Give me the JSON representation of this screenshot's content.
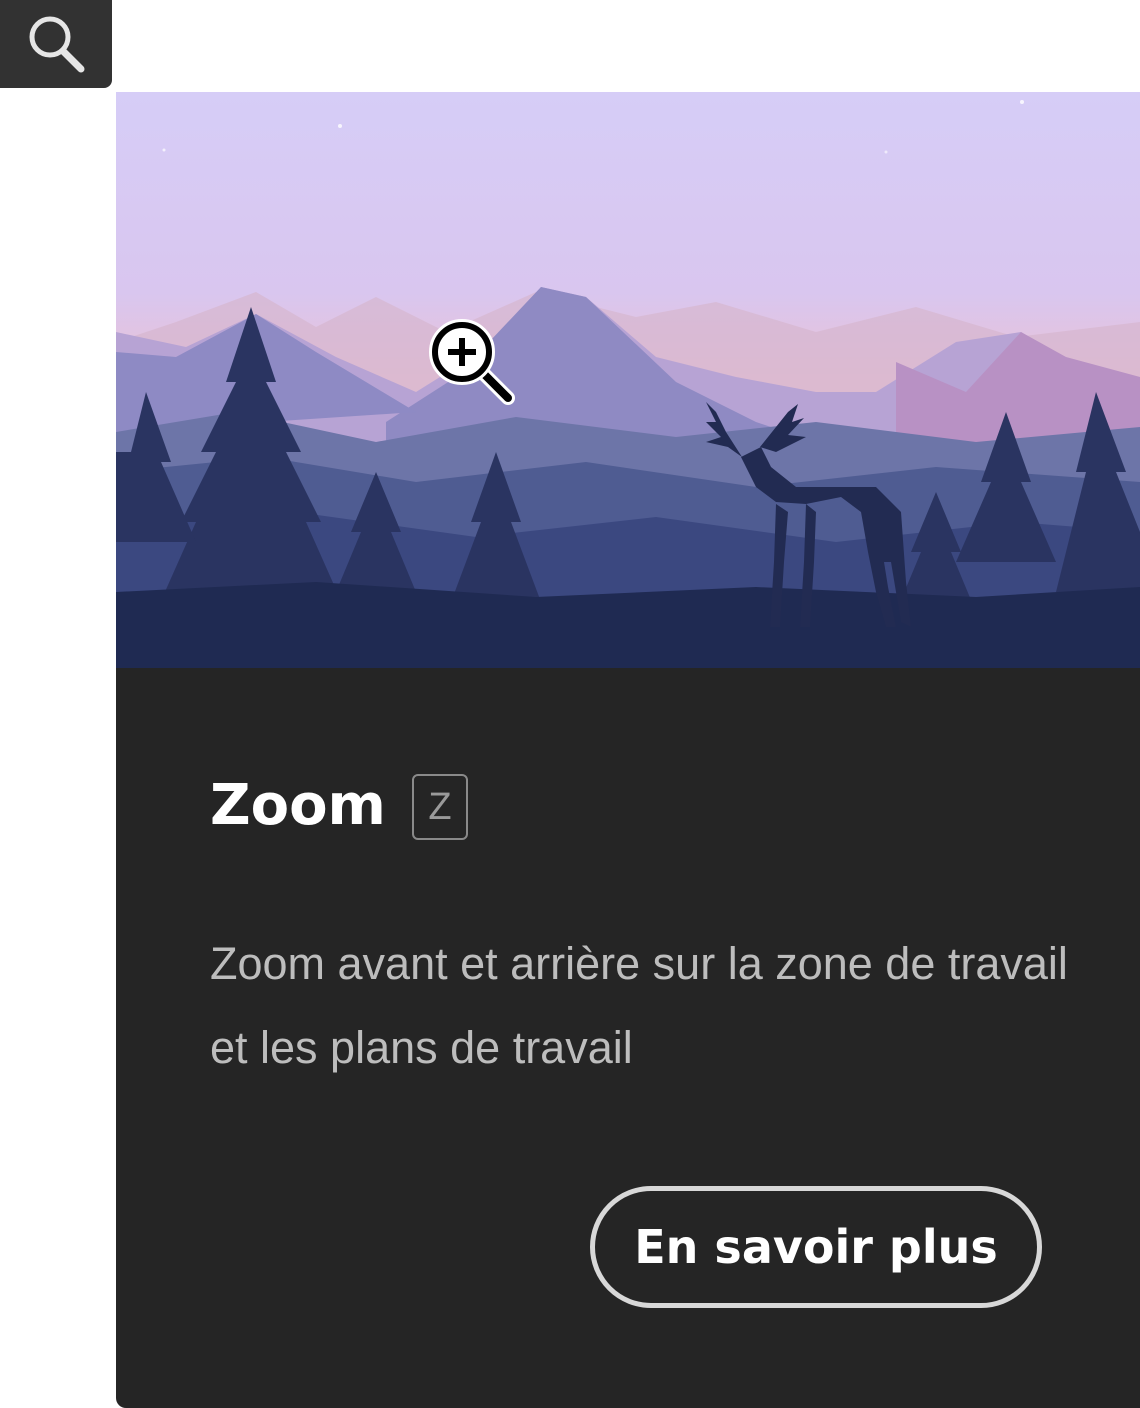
{
  "tool": {
    "icon": "search-icon"
  },
  "hero": {
    "illustration": "mountain-landscape-with-deer",
    "cursor_icon": "zoom-in-icon"
  },
  "card": {
    "title": "Zoom",
    "shortcut": "Z",
    "description": "Zoom avant et arrière sur la zone de travail et les plans de travail",
    "learn_more": "En savoir plus"
  },
  "colors": {
    "card_bg": "#252525",
    "tool_bg": "#323232",
    "text_primary": "#ffffff",
    "text_secondary": "#bdbdbd"
  }
}
